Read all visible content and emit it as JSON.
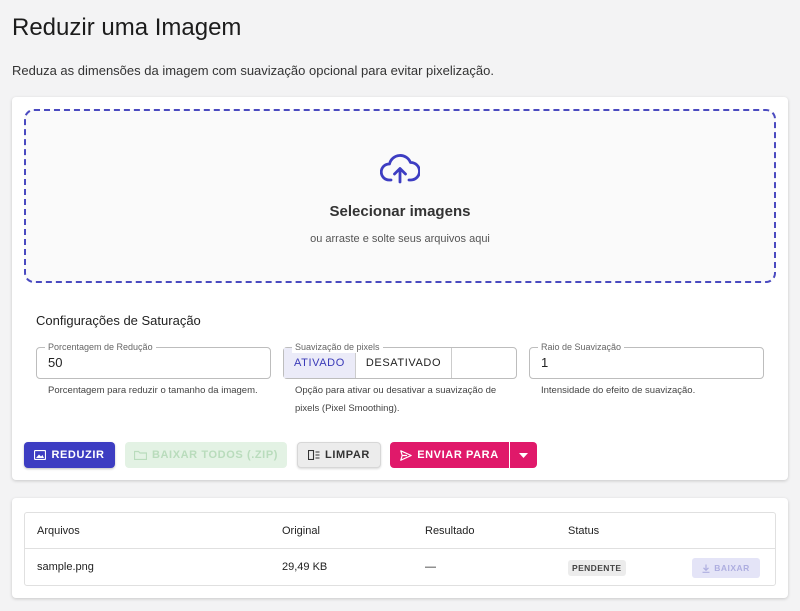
{
  "header": {
    "title": "Reduzir uma Imagem",
    "subtitle": "Reduza as dimensões da imagem com suavização opcional para evitar pixelização."
  },
  "dropzone": {
    "icon": "cloud-upload-icon",
    "title": "Selecionar imagens",
    "hint": "ou arraste e solte seus arquivos aqui"
  },
  "settings": {
    "title": "Configurações de Saturação",
    "reduction": {
      "label": "Porcentagem de Redução",
      "value": "50",
      "helper": "Porcentagem para reduzir o tamanho da imagem."
    },
    "smoothing": {
      "label": "Suavização de pixels",
      "options": [
        "ATIVADO",
        "DESATIVADO"
      ],
      "selected": "ATIVADO",
      "helper": "Opção para ativar ou desativar a suavização de pixels (Pixel Smoothing)."
    },
    "radius": {
      "label": "Raio de Suavização",
      "value": "1",
      "helper": "Intensidade do efeito de suavização."
    }
  },
  "actions": {
    "reduce": "REDUZIR",
    "download_all": "BAIXAR TODOS (.ZIP)",
    "clear": "LIMPAR",
    "send_to": "ENVIAR PARA"
  },
  "colors": {
    "primary": "#3d3dc2",
    "accent": "#e0196a",
    "success_disabled": "#e3f2e4"
  },
  "files_table": {
    "columns": [
      "Arquivos",
      "Original",
      "Resultado",
      "Status"
    ],
    "rows": [
      {
        "file": "sample.png",
        "original": "29,49 KB",
        "result": "—",
        "status": "PENDENTE",
        "action": "BAIXAR"
      }
    ]
  }
}
